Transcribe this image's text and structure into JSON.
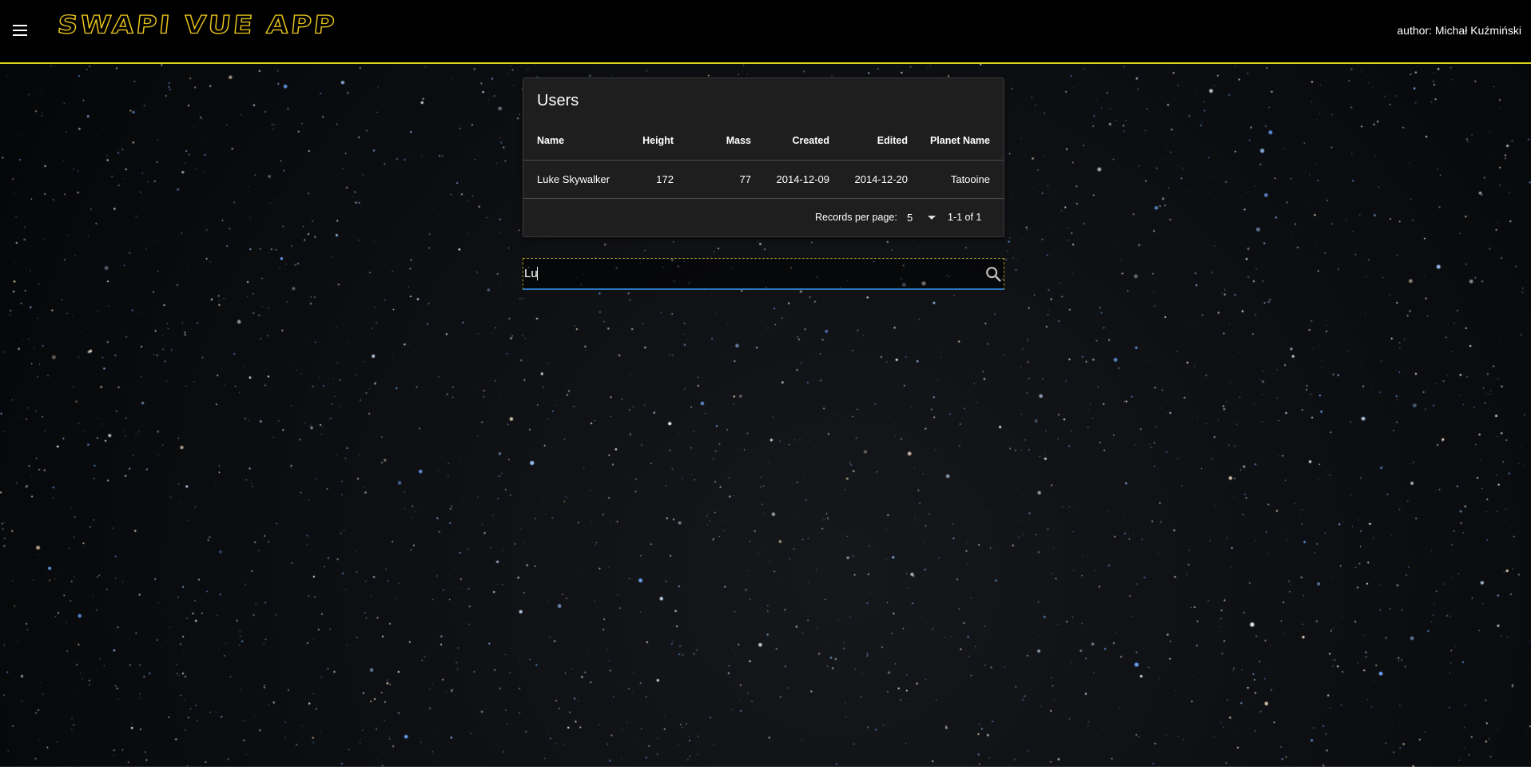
{
  "app": {
    "title": "SWAPI VUE APP",
    "author": "author: Michał Kuźmiński"
  },
  "users_card": {
    "title": "Users",
    "columns": [
      "Name",
      "Height",
      "Mass",
      "Created",
      "Edited",
      "Planet Name"
    ],
    "rows": [
      {
        "name": "Luke Skywalker",
        "height": "172",
        "mass": "77",
        "created": "2014-12-09",
        "edited": "2014-12-20",
        "planet_name": "Tatooine"
      }
    ],
    "footer": {
      "records_per_page_label": "Records per page:",
      "records_per_page_value": "5",
      "page_info": "1-1 of 1"
    }
  },
  "search": {
    "value": "Lu"
  },
  "colors": {
    "accent_yellow": "#e8c51a",
    "toolbar_border": "#d8d21a",
    "input_underline": "#2b79c2",
    "card_background": "#1e1e1e"
  },
  "icons": {
    "menu": "hamburger-menu-icon",
    "search": "magnifier-search-icon",
    "select": "caret-down-icon"
  }
}
